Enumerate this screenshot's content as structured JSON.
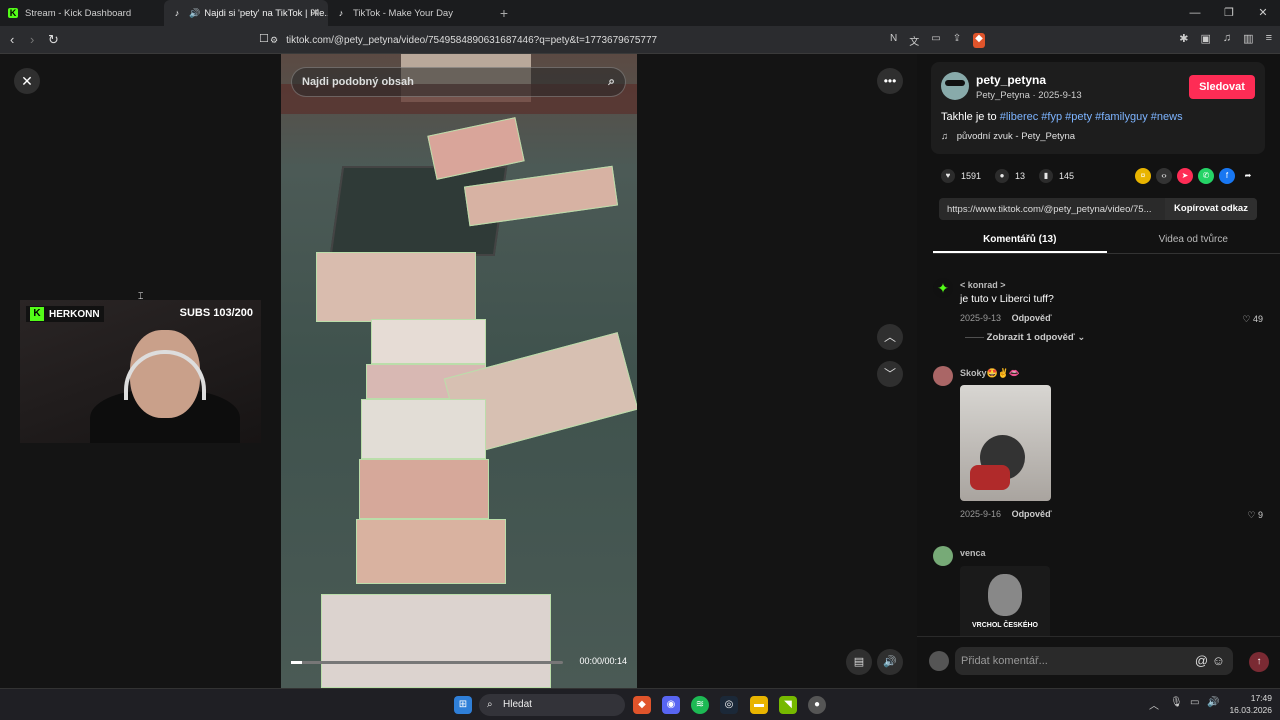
{
  "browser": {
    "tabs": [
      {
        "label": "Stream - Kick Dashboard",
        "active": false
      },
      {
        "label": "Najdi si 'pety' na TikTok | Hle...",
        "active": true
      },
      {
        "label": "TikTok - Make Your Day",
        "active": false
      }
    ],
    "url": "tiktok.com/@pety_petyna/video/7549584890631687446?q=pety&t=1773679675777"
  },
  "video": {
    "search_placeholder": "Najdi podobný obsah",
    "time": "00:00/00:14",
    "progress": 0.04
  },
  "overlay": {
    "channel": "HERKONN",
    "subs": "SUBS 103/200"
  },
  "post": {
    "username": "pety_petyna",
    "meta": "Pety_Petyna · 2025-9-13",
    "follow_label": "Sledovat",
    "caption_prefix": "Takhle je to ",
    "hashtags": [
      "#liberec",
      "#fyp",
      "#pety",
      "#familyguy",
      "#news"
    ],
    "sound": "původní zvuk - Pety_Petyna",
    "likes": "1591",
    "comments": "13",
    "saves": "145",
    "link": "https://www.tiktok.com/@pety_petyna/video/75...",
    "copy_label": "Kopírovat odkaz"
  },
  "tabs": {
    "comments": "Komentářů (13)",
    "creator": "Videa od tvůrce"
  },
  "comments": [
    {
      "name": "< konrad >",
      "text": "je tuto v Liberci tuff?",
      "date": "2025-9-13",
      "reply": "Odpověď",
      "likes": "49",
      "show_replies": "Zobrazit 1 odpověď"
    },
    {
      "name": "Skoky🤩✌️👄",
      "text": "",
      "date": "2025-9-16",
      "reply": "Odpověď",
      "likes": "9"
    },
    {
      "name": "venca",
      "thumb_text": "VRCHOL ČESKÉHO"
    }
  ],
  "composer": {
    "placeholder": "Přidat komentář..."
  },
  "taskbar": {
    "search": "Hledat",
    "time": "17:49",
    "date": "16.03.2026"
  }
}
